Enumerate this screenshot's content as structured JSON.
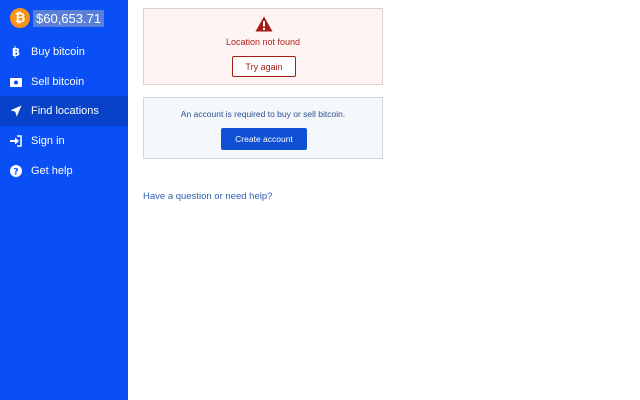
{
  "sidebar": {
    "price": "$60,653.71",
    "items": [
      {
        "label": "Buy bitcoin",
        "icon": "bitcoin-icon"
      },
      {
        "label": "Sell bitcoin",
        "icon": "cash-icon"
      },
      {
        "label": "Find locations",
        "icon": "location-arrow-icon",
        "active": true
      },
      {
        "label": "Sign in",
        "icon": "sign-in-icon"
      },
      {
        "label": "Get help",
        "icon": "question-circle-icon"
      }
    ]
  },
  "error_card": {
    "message": "Location not found",
    "button_label": "Try again"
  },
  "account_card": {
    "message": "An account is required to buy or sell bitcoin.",
    "button_label": "Create account"
  },
  "help_link": "Have a question or need help?",
  "colors": {
    "sidebar": "#0a4ef5",
    "active_item": "#0842c8",
    "bitcoin": "#f7931a",
    "error": "#b3261e",
    "primary_button": "#0f4fd4"
  }
}
